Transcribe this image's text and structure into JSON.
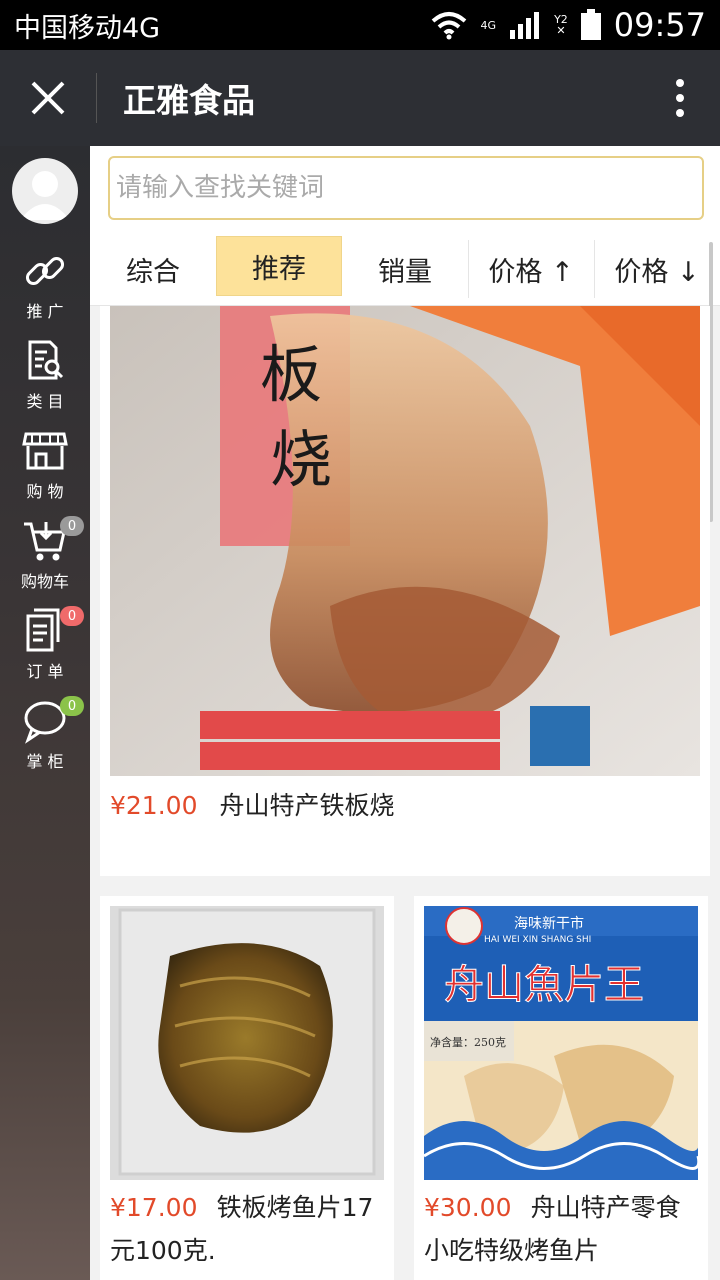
{
  "status_bar": {
    "carrier": "中国移动4G",
    "network": "4G",
    "sim": "Y2",
    "time": "09:57"
  },
  "titlebar": {
    "title": "正雅食品"
  },
  "sidebar": {
    "items": [
      {
        "label": "推 广",
        "icon": "link-icon"
      },
      {
        "label": "类 目",
        "icon": "category-search-icon"
      },
      {
        "label": "购 物",
        "icon": "store-icon"
      },
      {
        "label": "购物车",
        "icon": "cart-icon",
        "badge": "0"
      },
      {
        "label": "订 单",
        "icon": "order-icon",
        "badge": "0"
      },
      {
        "label": "掌 柜",
        "icon": "chat-icon",
        "badge": "0"
      }
    ]
  },
  "search": {
    "placeholder": "请输入查找关键词"
  },
  "sort_tabs": [
    "综合",
    "推荐",
    "销量",
    "价格 ↑",
    "价格 ↓"
  ],
  "active_sort": "推荐",
  "products": [
    {
      "price": "¥21.00",
      "name": "舟山特产铁板烧",
      "image_text": [
        "板",
        "烧"
      ]
    },
    {
      "price": "¥17.00",
      "name": "铁板烤鱼片17元100克."
    },
    {
      "price": "¥30.00",
      "name": "舟山特产零食小吃特级烤鱼片",
      "image_text": [
        "海味新干市",
        "HAI WEI XIN SHANG SHI",
        "舟山魚片王",
        "净含量：250克"
      ]
    }
  ],
  "colors": {
    "price": "#e24a2a",
    "active_tab": "#fde29a",
    "titlebar": "#2d2f34"
  }
}
